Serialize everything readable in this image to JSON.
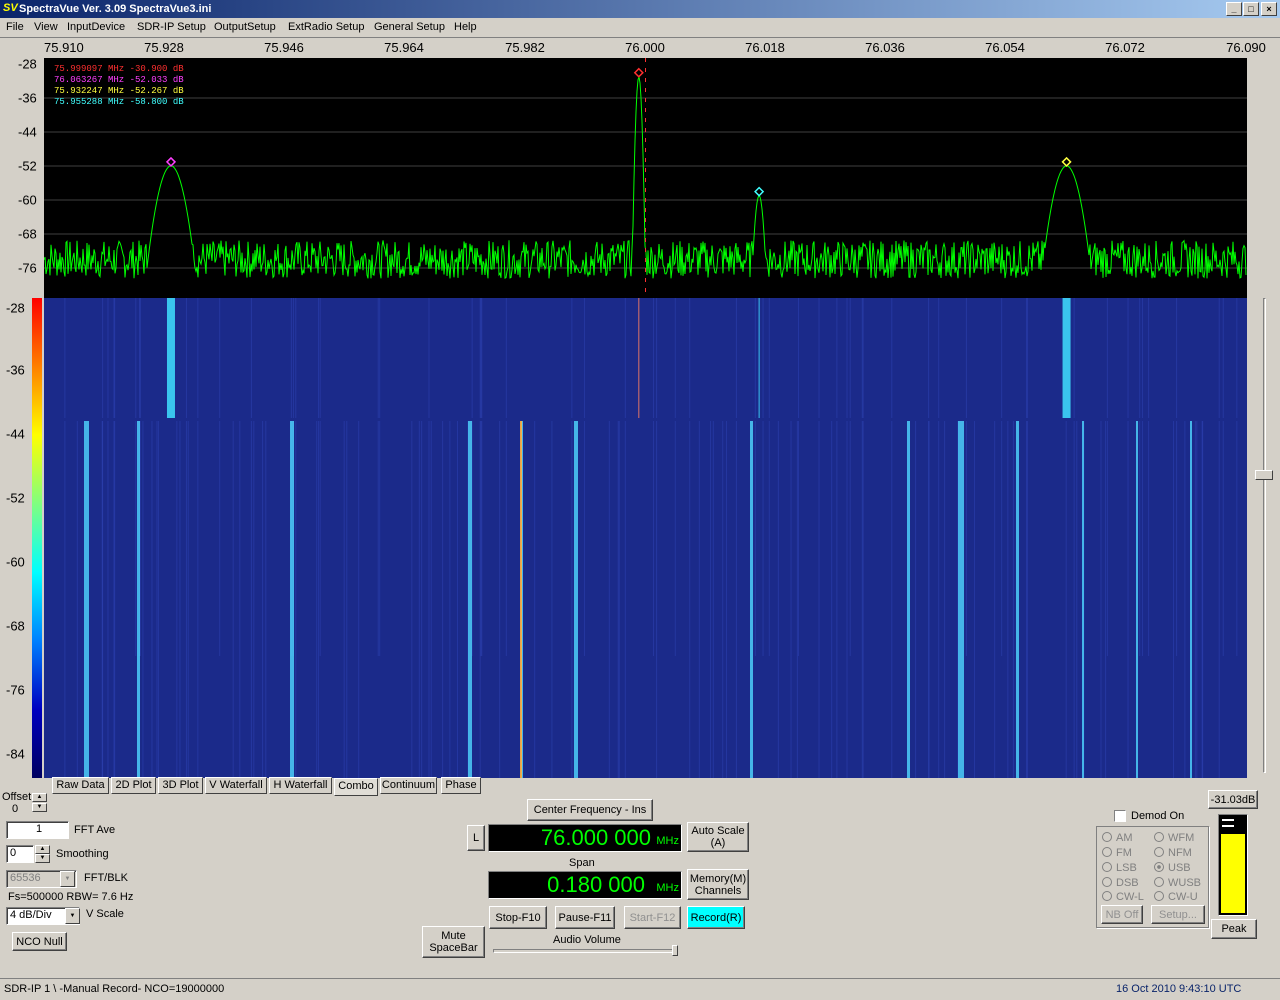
{
  "window": {
    "title": "SpectraVue Ver. 3.09   SpectraVue3.ini",
    "logo": "SV",
    "min": "_",
    "max": "□",
    "close": "×"
  },
  "menu": [
    "File",
    "View",
    "InputDevice",
    "SDR-IP Setup",
    "OutputSetup",
    "ExtRadio Setup",
    "General Setup",
    "Help"
  ],
  "x_ticks": [
    "75.910",
    "75.928",
    "75.946",
    "75.964",
    "75.982",
    "76.000",
    "76.018",
    "76.036",
    "76.054",
    "76.072",
    "76.090"
  ],
  "y_ticks_spectrum": [
    "-28",
    "-36",
    "-44",
    "-52",
    "-60",
    "-68",
    "-76"
  ],
  "y_ticks_waterfall": [
    "-28",
    "-36",
    "-44",
    "-52",
    "-60",
    "-68",
    "-76",
    "-84"
  ],
  "markers": [
    {
      "text": "75.999097 MHz  -30.900 dB",
      "color": "#ff3030"
    },
    {
      "text": "76.063267 MHz  -52.033 dB",
      "color": "#ff40ff"
    },
    {
      "text": "75.932247 MHz  -52.267 dB",
      "color": "#ffff40"
    },
    {
      "text": "75.955288 MHz  -58.800 dB",
      "color": "#40ffff"
    }
  ],
  "chart_data": {
    "type": "line",
    "title": "",
    "xlabel": "",
    "ylabel": "",
    "xlim": [
      75.91,
      76.09
    ],
    "ylim": [
      -80,
      -28
    ],
    "noise_floor_db": -74,
    "peaks": [
      {
        "freq": 75.929,
        "db": -52,
        "color": "#ff40ff"
      },
      {
        "freq": 75.999,
        "db": -31,
        "color": "#ff3030"
      },
      {
        "freq": 76.017,
        "db": -59,
        "color": "#40ffff"
      },
      {
        "freq": 76.063,
        "db": -52,
        "color": "#ffff40"
      }
    ]
  },
  "tabs": [
    "Raw Data",
    "2D Plot",
    "3D Plot",
    "V Waterfall",
    "H Waterfall",
    "Combo",
    "Continuum",
    "Phase"
  ],
  "active_tab": "Combo",
  "controls": {
    "offset_label": "Offset",
    "offset_value": "0",
    "fft_ave_value": "1",
    "fft_ave_label": "FFT Ave",
    "smoothing_value": "0",
    "smoothing_label": "Smoothing",
    "fft_blk_value": "65536",
    "fft_blk_label": "FFT/BLK",
    "fs_text": "Fs=500000 RBW= 7.6 Hz",
    "vscale_value": "4 dB/Div",
    "vscale_label": "V Scale",
    "nco_null": "NCO Null",
    "center_freq_btn": "Center Frequency - Ins",
    "l_btn": "L",
    "center_freq": "76.000 000",
    "center_unit": "MHz",
    "auto_scale": "Auto Scale\n(A)",
    "span_label": "Span",
    "span": "0.180 000",
    "span_unit": "MHz",
    "memory": "Memory(M)\nChannels",
    "mute": "Mute\nSpaceBar",
    "stop": "Stop-F10",
    "pause": "Pause-F11",
    "start": "Start-F12",
    "record": "Record(R)",
    "audio_volume": "Audio Volume",
    "demod_on": "Demod On",
    "level_db": "-31.03dB",
    "peak": "Peak",
    "nb_off": "NB Off",
    "setup": "Setup...",
    "modes_left": [
      "AM",
      "FM",
      "LSB",
      "DSB",
      "CW-L"
    ],
    "modes_right": [
      "WFM",
      "NFM",
      "USB",
      "WUSB",
      "CW-U"
    ],
    "selected_mode": "USB"
  },
  "status": {
    "left": "SDR-IP 1   \\ -Manual Record-   NCO=19000000",
    "right": "16 Oct 2010  9:43:10 UTC"
  }
}
